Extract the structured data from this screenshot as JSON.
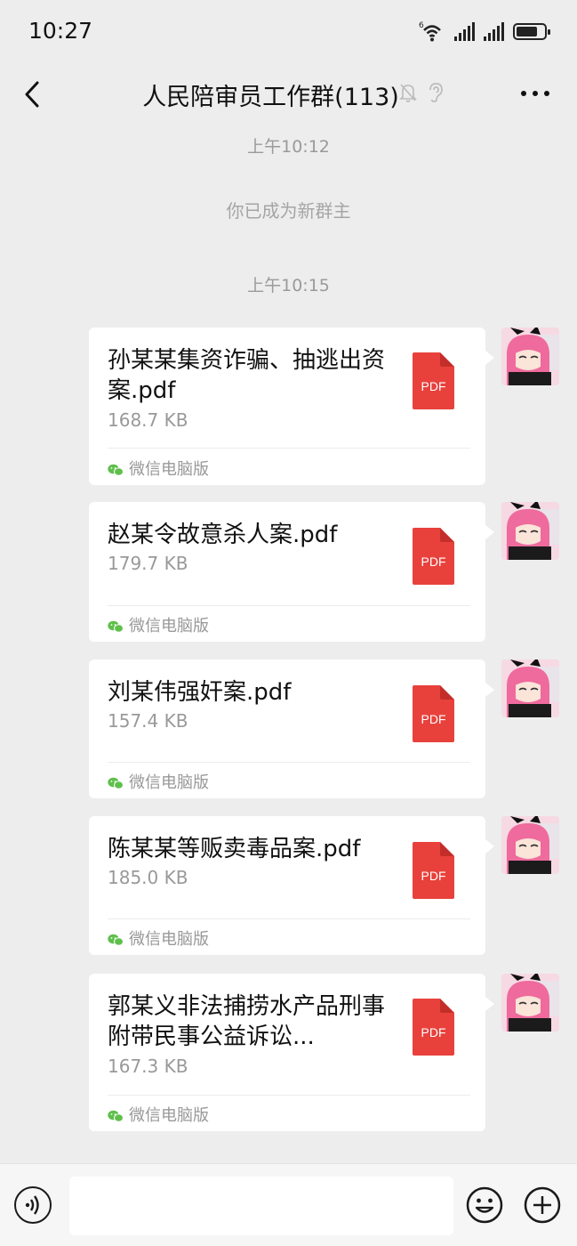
{
  "status_bar": {
    "time": "10:27",
    "network_label": "6",
    "battery_level": 0.75
  },
  "header": {
    "title": "人民陪审员工作群(113)",
    "icons": [
      "back-icon",
      "mute-bell-icon",
      "ear-icon",
      "more-icon"
    ]
  },
  "chat": {
    "timestamp_1": "上午10:12",
    "notice": "你已成为新群主",
    "timestamp_2": "上午10:15",
    "messages": [
      {
        "file_name": "孙某某集资诈骗、抽逃出资案.pdf",
        "size": "168.7 KB",
        "source": "微信电脑版",
        "file_type": "PDF"
      },
      {
        "file_name": "赵某令故意杀人案.pdf",
        "size": "179.7 KB",
        "source": "微信电脑版",
        "file_type": "PDF"
      },
      {
        "file_name": "刘某伟强奸案.pdf",
        "size": "157.4 KB",
        "source": "微信电脑版",
        "file_type": "PDF"
      },
      {
        "file_name": "陈某某等贩卖毒品案.pdf",
        "size": "185.0 KB",
        "source": "微信电脑版",
        "file_type": "PDF"
      },
      {
        "file_name": "郭某义非法捕捞水产品刑事附带民事公益诉讼...",
        "size": "167.3 KB",
        "source": "微信电脑版",
        "file_type": "PDF"
      }
    ]
  },
  "input_bar": {
    "text_value": "",
    "icons": [
      "voice-icon",
      "emoji-icon",
      "plus-icon"
    ]
  },
  "colors": {
    "background": "#ededed",
    "bubble": "#ffffff",
    "pdf_red": "#e8413c",
    "wechat_green": "#5fbf4b"
  }
}
